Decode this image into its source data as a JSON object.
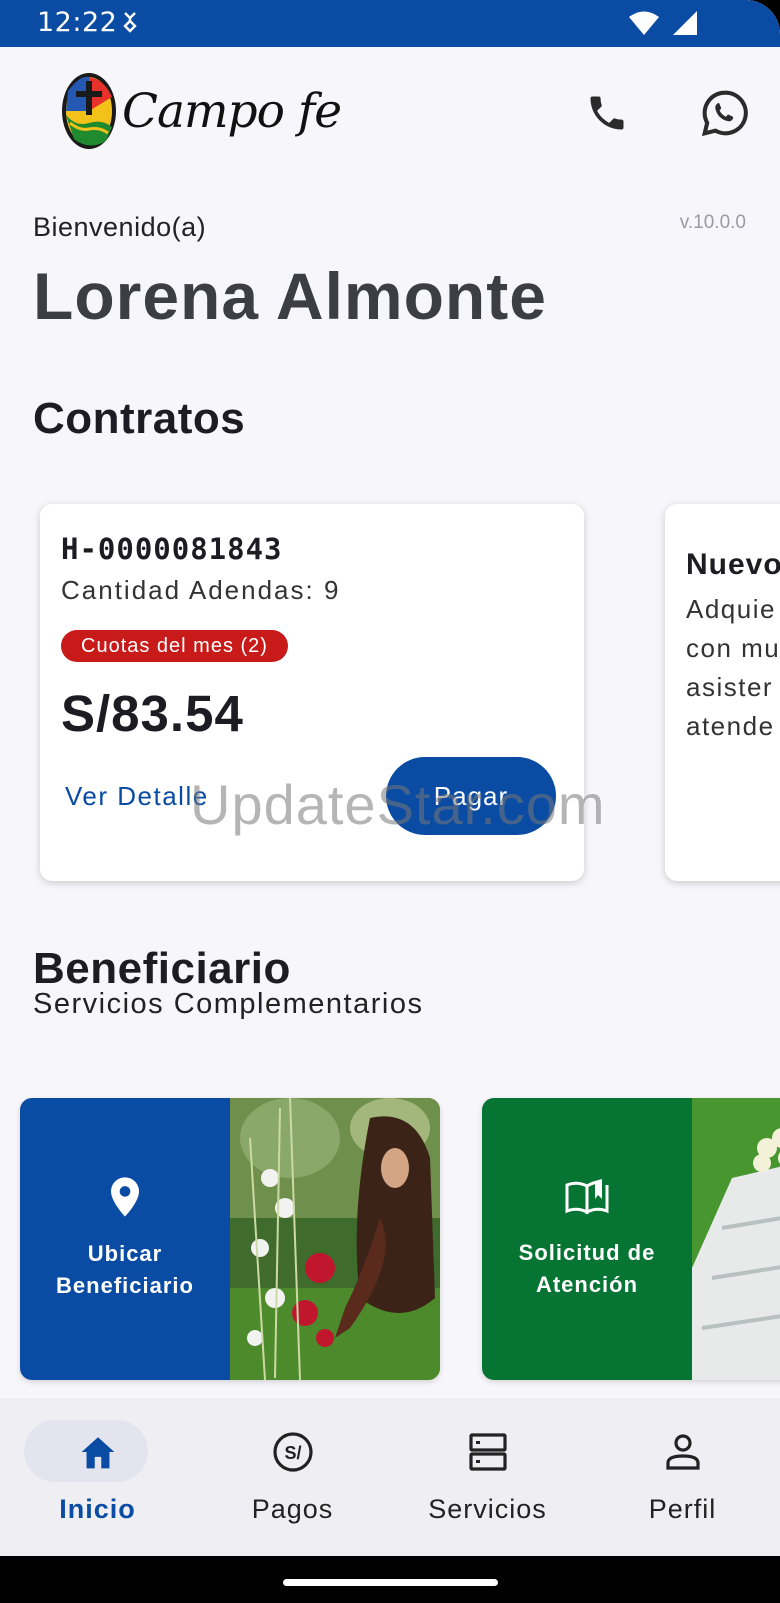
{
  "status_bar": {
    "time": "12:22"
  },
  "header": {
    "logo_text": "Campo fe"
  },
  "welcome": {
    "greeting": "Bienvenido(a)",
    "version": "v.10.0.0",
    "user_name": "Lorena Almonte"
  },
  "contracts": {
    "title": "Contratos",
    "card": {
      "id": "H-0000081843",
      "addenda": "Cantidad Adendas: 9",
      "badge": "Cuotas del mes (2)",
      "amount": "S/83.54",
      "detail_link": "Ver Detalle",
      "pay_button": "Pagar"
    },
    "promo_card": {
      "title": "Nuevo",
      "text": "Adquie\ncon mu\nasister\natende"
    }
  },
  "beneficiary": {
    "title": "Beneficiario",
    "subtitle": "Servicios Complementarios",
    "services": [
      {
        "label": "Ubicar\nBeneficiario",
        "icon": "location-pin-icon",
        "color": "#0a4ba3"
      },
      {
        "label": "Solicitud de\nAtención",
        "icon": "open-book-icon",
        "color": "#067433"
      }
    ]
  },
  "watermark": "UpdateStar.com",
  "bottom_nav": {
    "items": [
      {
        "label": "Inicio",
        "icon": "home-icon",
        "active": true
      },
      {
        "label": "Pagos",
        "icon": "soles-coin-icon",
        "active": false
      },
      {
        "label": "Servicios",
        "icon": "servers-icon",
        "active": false
      },
      {
        "label": "Perfil",
        "icon": "person-icon",
        "active": false
      }
    ]
  },
  "colors": {
    "primary": "#0a4ba3",
    "danger": "#c91a1a",
    "green": "#067433"
  }
}
